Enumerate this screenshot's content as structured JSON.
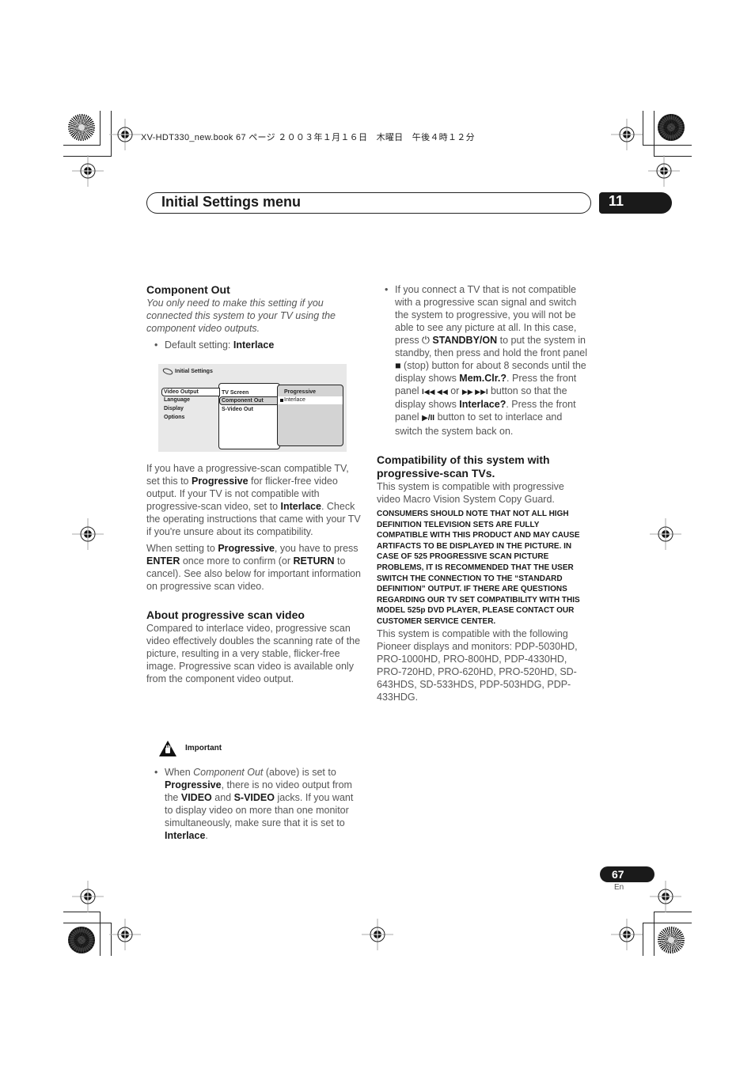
{
  "print_stamp": "XV-HDT330_new.book  67 ページ  ２００３年１月１６日　木曜日　午後４時１２分",
  "header": {
    "title": "Initial Settings menu",
    "chapter": "11"
  },
  "left_column": {
    "component_out": {
      "heading": "Component Out",
      "intro": "You only need to make this setting if you connected this system to your TV using the component video outputs.",
      "default_label": "Default setting: ",
      "default_value": "Interlace"
    },
    "osd": {
      "title": "Initial Settings",
      "menu": [
        "Video Output",
        "Language",
        "Display",
        "Options"
      ],
      "submenu": [
        "TV Screen",
        "Component Out",
        "S-Video Out"
      ],
      "options": [
        "Progressive",
        "Interlace"
      ],
      "selected_option": "Interlace"
    },
    "para1": {
      "t1": "If you have a progressive-scan compatible TV, set this to ",
      "b1": "Progressive",
      "t2": " for flicker-free video output. If your TV is not compatible with progressive-scan video, set to ",
      "b2": "Interlace",
      "t3": ". Check the operating instructions that came with your TV if you're unsure about its compatibility."
    },
    "para2": {
      "t1": "When setting to ",
      "b1": "Progressive",
      "t2": ", you have to press ",
      "b2": "ENTER",
      "t3": " once more to confirm (or ",
      "b3": "RETURN",
      "t4": " to cancel). See also below for important information on progressive scan video."
    },
    "about": {
      "heading": "About progressive scan video",
      "body": "Compared to interlace video, progressive scan video effectively doubles the scanning rate of the picture, resulting in a very stable, flicker-free image. Progressive scan video is available only from the component video output."
    },
    "important": {
      "label": "Important",
      "t1": "When ",
      "i1": "Component Out",
      "t2": " (above) is set to ",
      "b1": "Progressive",
      "t3": ", there is no video output from the ",
      "b2": "VIDEO",
      "t4": " and ",
      "b3": "S-VIDEO",
      "t5": " jacks. If you want to display video on more than one monitor simultaneously, make sure that it is set to ",
      "b4": "Interlace",
      "t6": "."
    }
  },
  "right_column": {
    "bullet": {
      "t1": "If you connect a TV that is not compatible with a progressive scan signal and switch the system to progressive, you will not be able to see any picture at all. In this case, press ",
      "power_symbol": "⏻",
      "b1": " STANDBY/ON",
      "t2": " to put the system in standby, then press and hold the front panel ",
      "stop_symbol": "■",
      "t3": " (stop) button for about 8 seconds until the display shows ",
      "b2": "Mem.Clr.?",
      "t4": ". Press the front panel ",
      "prev_symbols": "I◀◀ ◀◀",
      "t5": " or ",
      "next_symbols": "▶▶ ▶▶I",
      "t6": " button so that the display shows ",
      "b3": "Interlace?",
      "t7": ". Press the front panel ",
      "play_symbol": "▶/II",
      "t8": " button to set to interlace and switch the system back on."
    },
    "compat": {
      "heading": "Compatibility of this system with progressive-scan TVs.",
      "body": "This system is compatible with progressive video Macro Vision System Copy Guard.",
      "notice": "CONSUMERS SHOULD NOTE THAT NOT ALL HIGH DEFINITION TELEVISION SETS ARE FULLY COMPATIBLE WITH THIS PRODUCT AND MAY CAUSE ARTIFACTS TO BE DISPLAYED IN THE PICTURE. IN CASE OF 525 PROGRESSIVE SCAN PICTURE PROBLEMS, IT IS RECOMMENDED THAT THE USER SWITCH THE CONNECTION TO THE “STANDARD DEFINITION” OUTPUT. IF THERE ARE QUESTIONS REGARDING OUR TV SET COMPATIBILITY WITH THIS MODEL 525p DVD PLAYER, PLEASE CONTACT OUR CUSTOMER SERVICE CENTER.",
      "models": "This system is compatible with the following Pioneer displays and monitors: PDP-5030HD, PRO-1000HD, PRO-800HD, PDP-4330HD, PRO-720HD, PRO-620HD, PRO-520HD, SD-643HDS, SD-533HDS, PDP-503HDG, PDP-433HDG."
    }
  },
  "footer": {
    "page_number": "67",
    "language": "En"
  }
}
